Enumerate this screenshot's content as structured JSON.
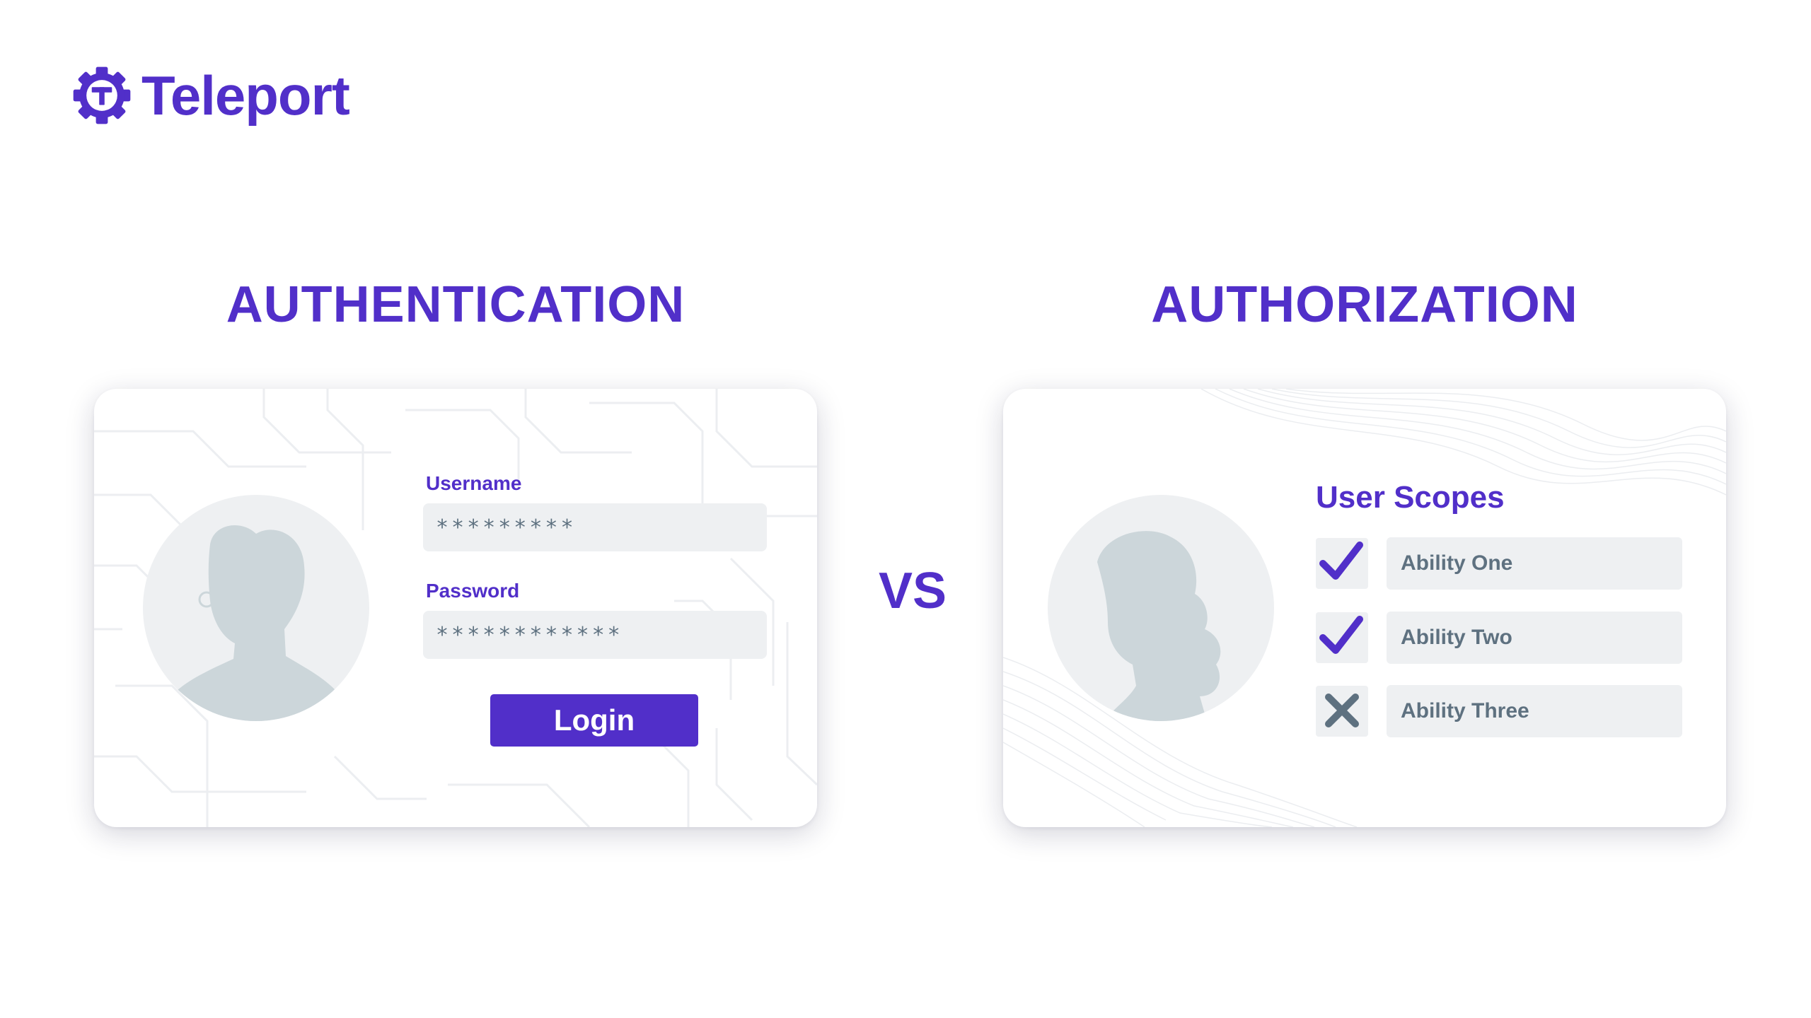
{
  "brand": {
    "name": "Teleport",
    "color": "#512fc9",
    "icon": "teleport-gear-logo-icon"
  },
  "headings": {
    "left": "AUTHENTICATION",
    "vs": "VS",
    "right": "AUTHORIZATION"
  },
  "auth_card": {
    "avatar_icon": "user-silhouette-icon",
    "username_label": "Username",
    "username_value": "*********",
    "password_label": "Password",
    "password_value": "************",
    "login_label": "Login"
  },
  "authz_card": {
    "avatar_icon": "user-silhouette-icon",
    "title": "User Scopes",
    "scopes": [
      {
        "label": "Ability One",
        "granted": true,
        "icon": "checkmark-icon"
      },
      {
        "label": "Ability Two",
        "granted": true,
        "icon": "checkmark-icon"
      },
      {
        "label": "Ability Three",
        "granted": false,
        "icon": "x-mark-icon"
      }
    ]
  },
  "colors": {
    "accent": "#512fc9",
    "field_bg": "#eef0f2",
    "muted_text": "#5e7180",
    "avatar_bg": "#eef0f2",
    "silhouette": "#ccd6da"
  }
}
